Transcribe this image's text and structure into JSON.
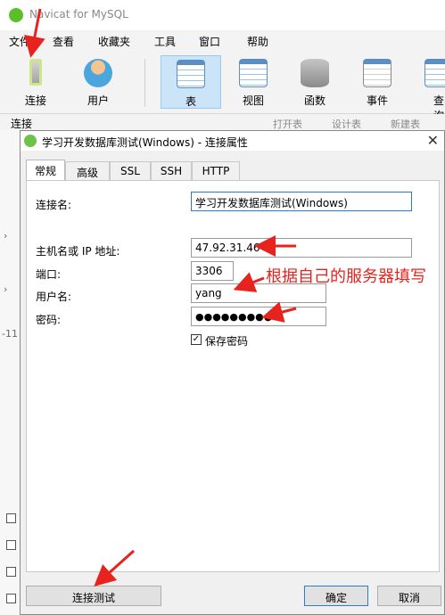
{
  "app": {
    "title": "Navicat for MySQL"
  },
  "menu": [
    "文件",
    "查看",
    "收藏夹",
    "工具",
    "窗口",
    "帮助"
  ],
  "toolbar": {
    "connect": "连接",
    "user": "用户",
    "table": "表",
    "view": "视图",
    "function": "函数",
    "event": "事件",
    "query": "查询"
  },
  "subbar": {
    "connect_label": "连接",
    "open_table": "打开表",
    "design_table": "设计表",
    "new_table": "新建表"
  },
  "sidebar_marks": {
    "row_count": "-11"
  },
  "dialog": {
    "title": "学习开发数据库测试(Windows) - 连接属性",
    "tabs": [
      "常规",
      "高级",
      "SSL",
      "SSH",
      "HTTP"
    ],
    "fields": {
      "conn_name_label": "连接名:",
      "conn_name": "学习开发数据库测试(Windows)",
      "host_label": "主机名或 IP 地址:",
      "host": "47.92.31.46",
      "port_label": "端口:",
      "port": "3306",
      "user_label": "用户名:",
      "user": "yang",
      "password_label": "密码:",
      "password": "●●●●●●●●●"
    },
    "save_password": {
      "label": "保存密码",
      "checked": true
    },
    "buttons": {
      "test": "连接测试",
      "ok": "确定",
      "cancel": "取消"
    }
  },
  "annotation": {
    "text": "根据自己的服务器填写",
    "color": "#e8231d"
  }
}
